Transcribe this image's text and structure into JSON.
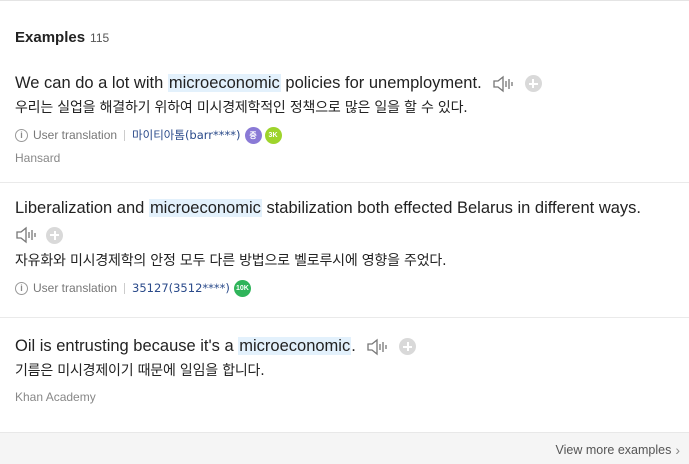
{
  "header": {
    "title": "Examples",
    "count": "115"
  },
  "examples": [
    {
      "en_before": "We can do a lot with ",
      "en_highlight": "microeconomic",
      "en_after": " policies for unemployment.",
      "ko": "우리는 실업을 해결하기 위하여 미시경제학적인 정책으로 많은 일을 할 수 있다.",
      "translation_label": "User translation",
      "user": "마이티아톰(barr****)",
      "badges": [
        "중",
        "3K"
      ]
    },
    {
      "en_before": "Liberalization and ",
      "en_highlight": "microeconomic",
      "en_after": " stabilization both effected Belarus in different ways.",
      "ko": "자유화와 미시경제학의 안정 모두 다른 방법으로 벨로루시에 영향을 주었다.",
      "translation_label": "User translation",
      "user": "35127(3512****)",
      "badges": [
        "10K"
      ]
    },
    {
      "en_before": "Oil is entrusting because it's a ",
      "en_highlight": "microeconomic",
      "en_after": ".",
      "ko": "기름은 미시경제이기 때문에 일임을 합니다.",
      "source": "Khan Academy"
    }
  ],
  "sources": {
    "first": "Hansard"
  },
  "footer": {
    "more_label": "View more examples"
  },
  "icons": {
    "speaker": "speaker-icon",
    "add": "plus-circle-icon",
    "info": "info-icon",
    "chevron": "chevron-right-icon"
  },
  "colors": {
    "highlight": "#e3f1fc",
    "user_link": "#2a4a8a",
    "badge_purple": "#8a7ad6",
    "badge_lime": "#9ed42c",
    "badge_green": "#2fb45a"
  }
}
